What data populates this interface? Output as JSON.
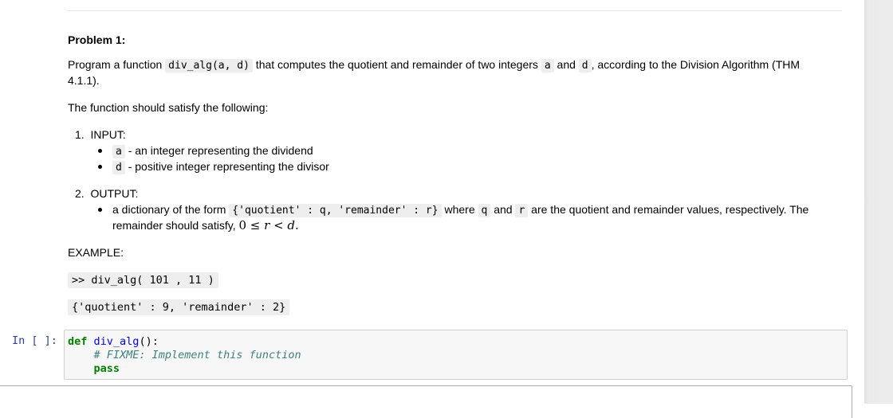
{
  "markdown": {
    "heading": "Problem 1:",
    "intro": {
      "prefix": "Program a function ",
      "func_signature": "div_alg(a, d)",
      "middle": " that computes the quotient and remainder of two integers ",
      "var_a": "a",
      "and": " and ",
      "var_d": "d",
      "suffix": ", according to the Division Algorithm (THM",
      "line2": "4.1.1)."
    },
    "satisfy_text": "The function should satisfy the following:",
    "input": {
      "number": "1.",
      "label": "INPUT:",
      "items": [
        {
          "code": "a",
          "text": " - an integer representing the dividend"
        },
        {
          "code": "d",
          "text": " - positive integer representing the divisor"
        }
      ]
    },
    "output": {
      "number": "2.",
      "label": "OUTPUT:",
      "item": {
        "prefix": "a dictionary of the form ",
        "code": "{'quotient' : q, 'remainder' : r}",
        "where": " where ",
        "q": "q",
        "and": " and ",
        "r": "r",
        "suffix": " are the quotient and remainder values, respectively. The",
        "line2": "remainder should satisfy, ",
        "math": {
          "zero": "0",
          "le": " ≤ ",
          "r": "r",
          "lt": " < ",
          "d": "d",
          "end": "."
        }
      }
    },
    "example_label": "EXAMPLE:",
    "example_call": ">> div_alg( 101 , 11 )",
    "example_result": "{'quotient' : 9, 'remainder' : 2}"
  },
  "code_cell": {
    "prompt": "In [ ]:",
    "lines": {
      "def_kw": "def",
      "func_name": "div_alg",
      "parens": "():",
      "comment": "# FIXME: Implement this function",
      "pass_kw": "pass"
    }
  }
}
